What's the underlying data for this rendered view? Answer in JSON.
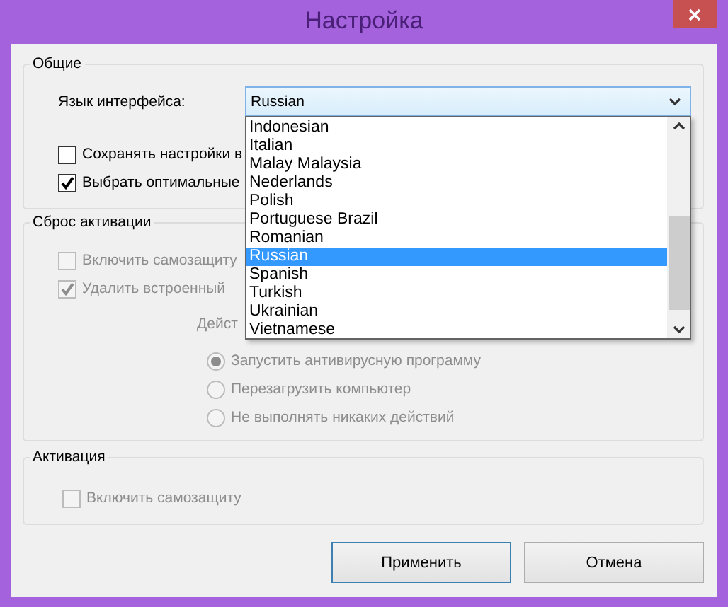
{
  "window": {
    "title": "Настройка"
  },
  "general": {
    "title": "Общие",
    "language_label": "Язык интерфейса:",
    "language_value": "Russian",
    "checkboxes": [
      {
        "label": "Сохранять настройки в",
        "checked": false,
        "disabled": false
      },
      {
        "label": "Выбрать оптимальные",
        "checked": true,
        "disabled": false
      }
    ]
  },
  "language_list": {
    "expanded": true,
    "items": [
      {
        "label": "Indonesian",
        "selected": false
      },
      {
        "label": "Italian",
        "selected": false
      },
      {
        "label": "Malay Malaysia",
        "selected": false
      },
      {
        "label": "Nederlands",
        "selected": false
      },
      {
        "label": "Polish",
        "selected": false
      },
      {
        "label": "Portuguese Brazil",
        "selected": false
      },
      {
        "label": "Romanian",
        "selected": false
      },
      {
        "label": "Russian",
        "selected": true
      },
      {
        "label": "Spanish",
        "selected": false
      },
      {
        "label": "Turkish",
        "selected": false
      },
      {
        "label": "Ukrainian",
        "selected": false
      },
      {
        "label": "Vietnamese",
        "selected": false
      }
    ]
  },
  "reset": {
    "title": "Сброс активации",
    "checkboxes": [
      {
        "label": "Включить самозащиту",
        "checked": false,
        "disabled": true
      },
      {
        "label": "Удалить встроенный",
        "checked": true,
        "disabled": true
      }
    ],
    "action_label": "Дейст",
    "radios": [
      {
        "label": "Запустить антивирусную программу",
        "selected": true,
        "disabled": true
      },
      {
        "label": "Перезагрузить компьютер",
        "selected": false,
        "disabled": true
      },
      {
        "label": "Не выполнять никаких действий",
        "selected": false,
        "disabled": true
      }
    ]
  },
  "activation": {
    "title": "Активация",
    "checkboxes": [
      {
        "label": "Включить самозащиту",
        "checked": false,
        "disabled": true
      }
    ]
  },
  "buttons": [
    {
      "label": "Применить",
      "default": true
    },
    {
      "label": "Отмена",
      "default": false
    }
  ]
}
